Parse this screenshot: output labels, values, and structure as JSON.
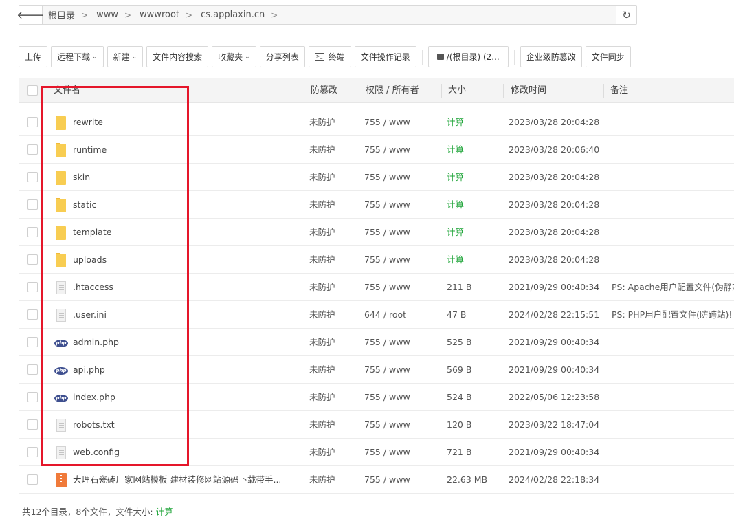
{
  "path": {
    "crumbs": [
      "根目录",
      "www",
      "wwwroot",
      "cs.applaxin.cn"
    ]
  },
  "toolbar": {
    "upload": "上传",
    "remote_download": "远程下载",
    "new": "新建",
    "content_search": "文件内容搜索",
    "favorites": "收藏夹",
    "share_list": "分享列表",
    "terminal": "终端",
    "op_log": "文件操作记录",
    "disk": "/(根目录) (2...",
    "tamper": "企业级防篡改",
    "sync": "文件同步"
  },
  "table": {
    "headers": {
      "name": "文件名",
      "protect": "防篡改",
      "perm": "权限 / 所有者",
      "size": "大小",
      "mtime": "修改时间",
      "note": "备注"
    },
    "rows": [
      {
        "icon": "folder-icon",
        "name": "rewrite",
        "protect": "未防护",
        "perm": "755 / www",
        "size": "计算",
        "mtime": "2023/03/28 20:04:28",
        "note": ""
      },
      {
        "icon": "folder-icon",
        "name": "runtime",
        "protect": "未防护",
        "perm": "755 / www",
        "size": "计算",
        "mtime": "2023/03/28 20:06:40",
        "note": ""
      },
      {
        "icon": "folder-icon",
        "name": "skin",
        "protect": "未防护",
        "perm": "755 / www",
        "size": "计算",
        "mtime": "2023/03/28 20:04:28",
        "note": ""
      },
      {
        "icon": "folder-icon",
        "name": "static",
        "protect": "未防护",
        "perm": "755 / www",
        "size": "计算",
        "mtime": "2023/03/28 20:04:28",
        "note": ""
      },
      {
        "icon": "folder-icon",
        "name": "template",
        "protect": "未防护",
        "perm": "755 / www",
        "size": "计算",
        "mtime": "2023/03/28 20:04:28",
        "note": ""
      },
      {
        "icon": "folder-icon",
        "name": "uploads",
        "protect": "未防护",
        "perm": "755 / www",
        "size": "计算",
        "mtime": "2023/03/28 20:04:28",
        "note": ""
      },
      {
        "icon": "file-icon",
        "name": ".htaccess",
        "protect": "未防护",
        "perm": "755 / www",
        "size": "211 B",
        "mtime": "2021/09/29 00:40:34",
        "note": "PS: Apache用户配置文件(伪静态)"
      },
      {
        "icon": "file-icon",
        "name": ".user.ini",
        "protect": "未防护",
        "perm": "644 / root",
        "size": "47 B",
        "mtime": "2024/02/28 22:15:51",
        "note": "PS: PHP用户配置文件(防跨站)!"
      },
      {
        "icon": "php-icon",
        "name": "admin.php",
        "protect": "未防护",
        "perm": "755 / www",
        "size": "525 B",
        "mtime": "2021/09/29 00:40:34",
        "note": ""
      },
      {
        "icon": "php-icon",
        "name": "api.php",
        "protect": "未防护",
        "perm": "755 / www",
        "size": "569 B",
        "mtime": "2021/09/29 00:40:34",
        "note": ""
      },
      {
        "icon": "php-icon",
        "name": "index.php",
        "protect": "未防护",
        "perm": "755 / www",
        "size": "524 B",
        "mtime": "2022/05/06 12:23:58",
        "note": ""
      },
      {
        "icon": "file-icon",
        "name": "robots.txt",
        "protect": "未防护",
        "perm": "755 / www",
        "size": "120 B",
        "mtime": "2023/03/22 18:47:04",
        "note": ""
      },
      {
        "icon": "file-icon",
        "name": "web.config",
        "protect": "未防护",
        "perm": "755 / www",
        "size": "721 B",
        "mtime": "2021/09/29 00:40:34",
        "note": ""
      },
      {
        "icon": "zip-icon",
        "name": "大理石瓷砖厂家网站模板 建材装修网站源码下载带手...",
        "protect": "未防护",
        "perm": "755 / www",
        "size": "22.63 MB",
        "mtime": "2024/02/28 22:18:34",
        "note": ""
      }
    ]
  },
  "footer": {
    "summary": "共12个目录，8个文件，文件大小: ",
    "calc": "计算"
  },
  "colors": {
    "accent_green": "#20a53a",
    "highlight_red": "#e5162a"
  }
}
